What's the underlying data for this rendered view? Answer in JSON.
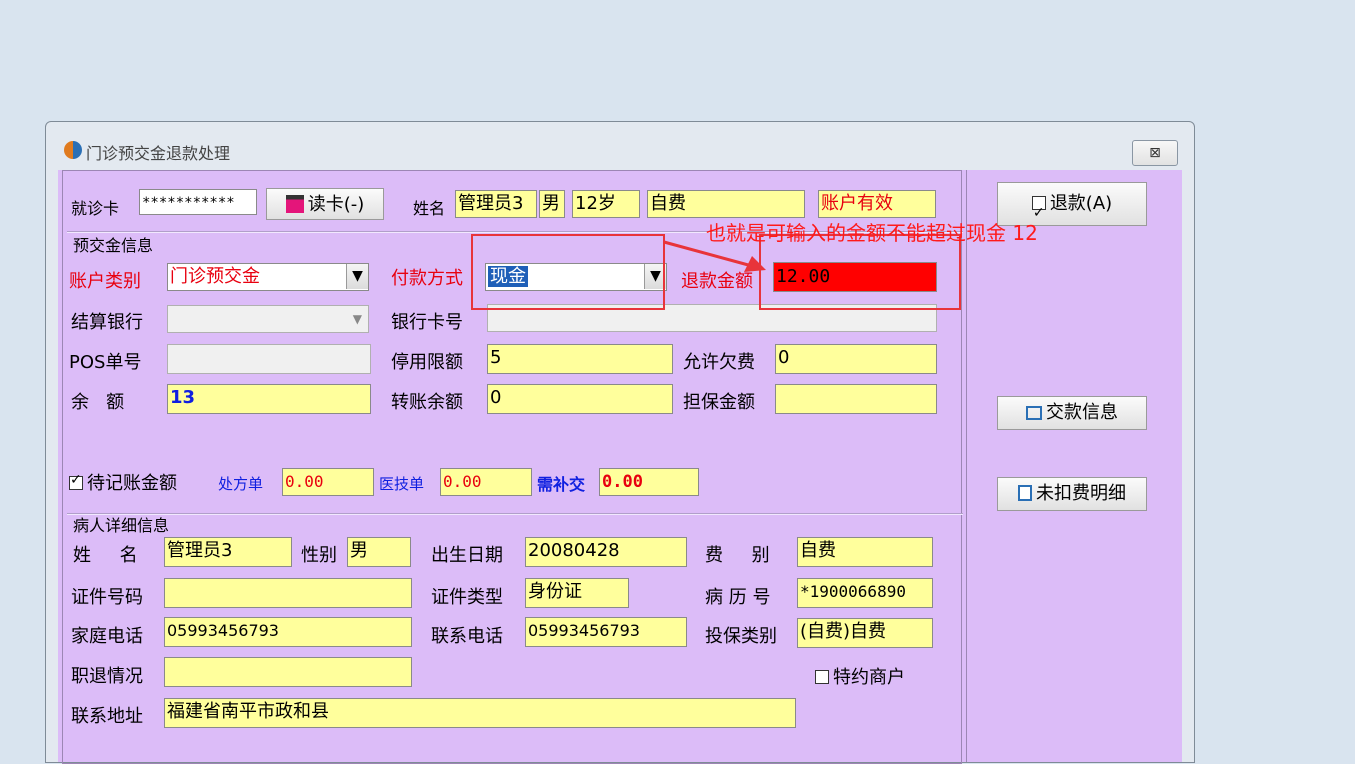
{
  "window": {
    "title": "门诊预交金退款处理",
    "close_label": "⊠"
  },
  "card": {
    "label": "就诊卡",
    "value": "***********",
    "read_button": "读卡(-)",
    "name_label": "姓名",
    "name": "管理员3",
    "sex": "男",
    "age": "12岁",
    "fee_type": "自费",
    "status": "账户有效"
  },
  "prepay": {
    "section_title": "预交金信息",
    "account_type_label": "账户类别",
    "account_type": "门诊预交金",
    "pay_method_label": "付款方式",
    "pay_method": "现金",
    "refund_amount_label": "退款金额",
    "refund_amount": "12.00",
    "bank_label": "结算银行",
    "bank": "",
    "bank_card_label": "银行卡号",
    "bank_card": "",
    "pos_label": "POS单号",
    "pos": "",
    "stop_limit_label": "停用限额",
    "stop_limit": "5",
    "allow_debt_label": "允许欠费",
    "allow_debt": "0",
    "balance_label": "余   额",
    "balance": "13",
    "transfer_balance_label": "转账余额",
    "transfer_balance": "0",
    "guarantee_label": "担保金额",
    "guarantee": "",
    "pending_label": "待记账金额",
    "pending_checked": true,
    "prescription_label": "处方单",
    "prescription": "0.00",
    "medtech_label": "医技单",
    "medtech": "0.00",
    "supplement_label": "需补交",
    "supplement": "0.00"
  },
  "patient": {
    "section_title": "病人详细信息",
    "name_label": "姓     名",
    "name": "管理员3",
    "sex_label": "性别",
    "sex": "男",
    "birth_label": "出生日期",
    "birth": "20080428",
    "fee_label": "费     别",
    "fee": "自费",
    "id_label": "证件号码",
    "id": "",
    "id_type_label": "证件类型",
    "id_type": "身份证",
    "record_label": "病 历 号",
    "record": "*1900066890",
    "home_phone_label": "家庭电话",
    "home_phone": "05993456793",
    "contact_phone_label": "联系电话",
    "contact_phone": "05993456793",
    "insurance_label": "投保类别",
    "insurance": "(自费)自费",
    "retire_label": "职退情况",
    "retire": "",
    "special_label": "特约商户",
    "special_checked": false,
    "address_label": "联系地址",
    "address": "福建省南平市政和县"
  },
  "actions": {
    "refund": "退款(A)",
    "payment_info": "交款信息",
    "undeducted": "未扣费明细"
  },
  "annotation": {
    "text": "也就是可输入的金额不能超过现金 12"
  },
  "colors": {
    "panel": "#dcbcf8",
    "field": "#ffff9c",
    "highlight": "#ff0000",
    "annotation": "#ff1a1a"
  }
}
